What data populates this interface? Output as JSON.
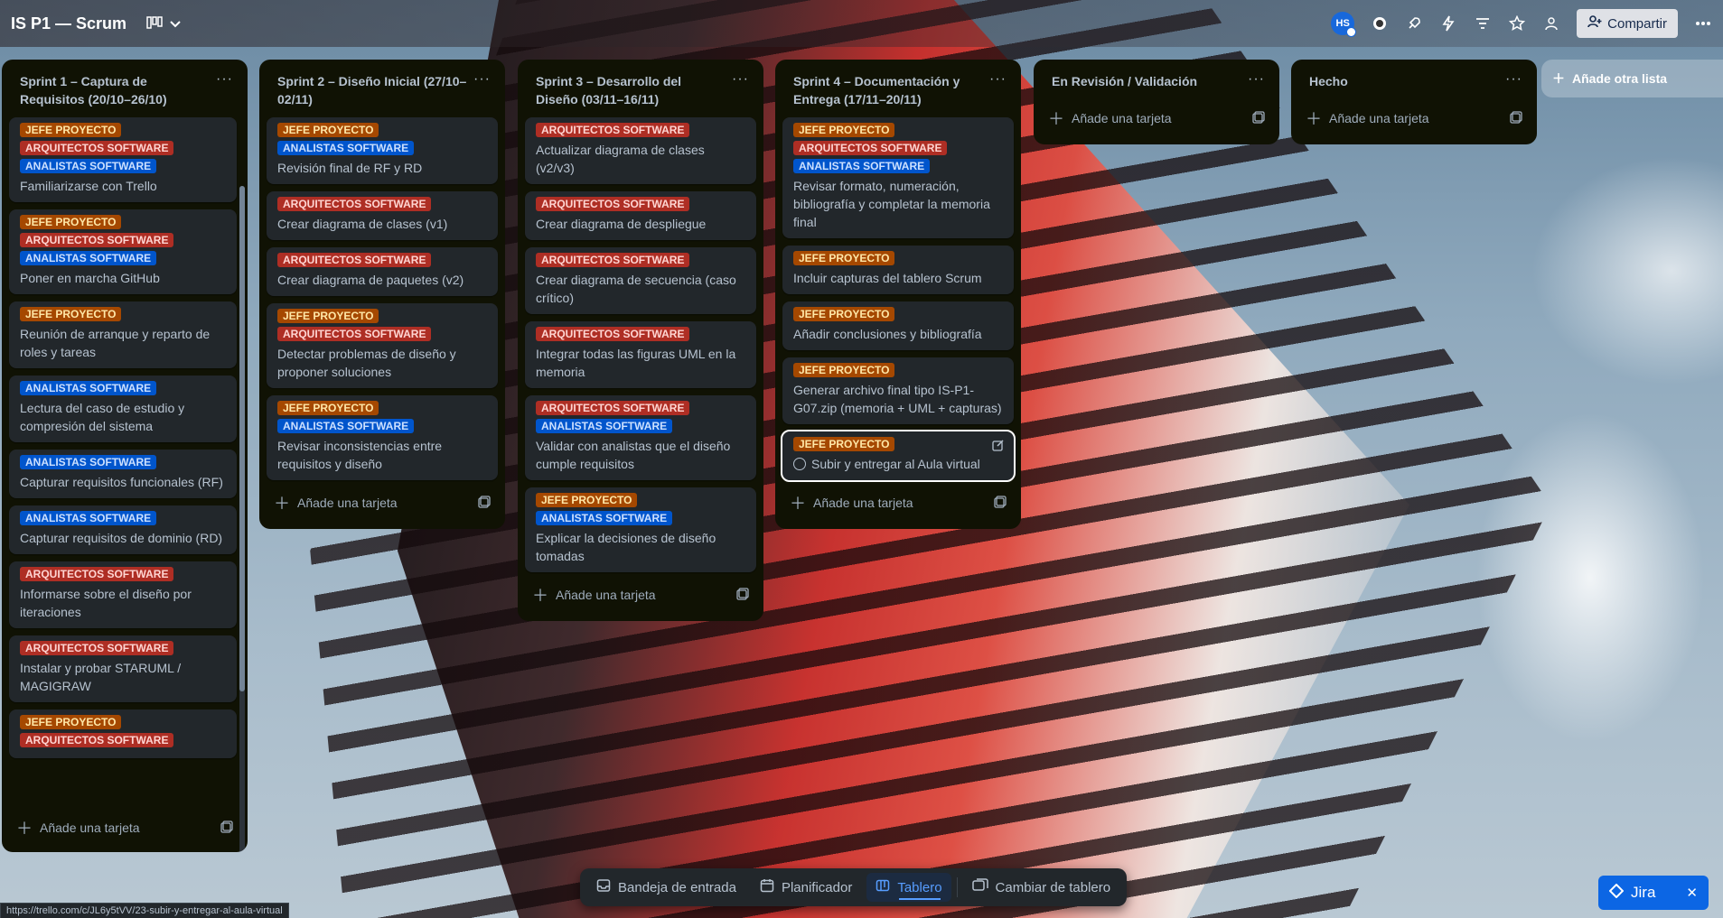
{
  "header": {
    "board_title": "IS P1 — Scrum",
    "avatar_initials": "HS",
    "share_label": "Compartir"
  },
  "label_names": {
    "jefe": "JEFE PROYECTO",
    "arq": "ARQUITECTOS SOFTWARE",
    "ana": "ANALISTAS SOFTWARE"
  },
  "label_colors": {
    "jefe": "#a54800",
    "arq": "#ae2e24",
    "ana": "#0055cc"
  },
  "add_card_label": "Añade una tarjeta",
  "add_list_label": "Añade otra lista",
  "lists": [
    {
      "title": "Sprint 1 – Captura de Requisitos (20/10–26/10)",
      "cards": [
        {
          "labels": [
            "jefe",
            "arq",
            "ana"
          ],
          "title": "Familiarizarse con Trello"
        },
        {
          "labels": [
            "jefe",
            "arq",
            "ana"
          ],
          "title": "Poner en marcha GitHub"
        },
        {
          "labels": [
            "jefe"
          ],
          "title": "Reunión de arranque y reparto de roles y tareas"
        },
        {
          "labels": [
            "ana"
          ],
          "title": "Lectura del caso de estudio y compresión del sistema"
        },
        {
          "labels": [
            "ana"
          ],
          "title": "Capturar requisitos funcionales (RF)"
        },
        {
          "labels": [
            "ana"
          ],
          "title": "Capturar requisitos de dominio (RD)"
        },
        {
          "labels": [
            "arq"
          ],
          "title": "Informarse sobre el diseño por iteraciones"
        },
        {
          "labels": [
            "arq"
          ],
          "title": "Instalar y probar STARUML / MAGIGRAW"
        },
        {
          "labels": [
            "jefe",
            "arq"
          ],
          "title": ""
        }
      ]
    },
    {
      "title": "Sprint 2 – Diseño Inicial (27/10–02/11)",
      "cards": [
        {
          "labels": [
            "jefe",
            "ana"
          ],
          "title": "Revisión final de RF y RD"
        },
        {
          "labels": [
            "arq"
          ],
          "title": "Crear diagrama de clases (v1)"
        },
        {
          "labels": [
            "arq"
          ],
          "title": "Crear diagrama de paquetes (v2)"
        },
        {
          "labels": [
            "jefe",
            "arq"
          ],
          "title": "Detectar problemas de diseño y proponer soluciones"
        },
        {
          "labels": [
            "jefe",
            "ana"
          ],
          "title": "Revisar inconsistencias entre requisitos y diseño"
        }
      ]
    },
    {
      "title": "Sprint 3 – Desarrollo del Diseño (03/11–16/11)",
      "cards": [
        {
          "labels": [
            "arq"
          ],
          "title": "Actualizar diagrama de clases (v2/v3)"
        },
        {
          "labels": [
            "arq"
          ],
          "title": "Crear diagrama de despliegue"
        },
        {
          "labels": [
            "arq"
          ],
          "title": "Crear diagrama de secuencia (caso crítico)"
        },
        {
          "labels": [
            "arq"
          ],
          "title": "Integrar todas las figuras UML en la memoria"
        },
        {
          "labels": [
            "arq",
            "ana"
          ],
          "title": "Validar con analistas que el diseño cumple requisitos"
        },
        {
          "labels": [
            "jefe",
            "ana"
          ],
          "title": "Explicar la decisiones de diseño tomadas"
        }
      ]
    },
    {
      "title": "Sprint 4 – Documentación y Entrega (17/11–20/11)",
      "cards": [
        {
          "labels": [
            "jefe",
            "arq",
            "ana"
          ],
          "title": "Revisar formato, numeración, bibliografía y completar la memoria final"
        },
        {
          "labels": [
            "jefe"
          ],
          "title": "Incluir capturas del tablero Scrum"
        },
        {
          "labels": [
            "jefe"
          ],
          "title": "Añadir conclusiones y bibliografía"
        },
        {
          "labels": [
            "jefe"
          ],
          "title": "Generar archivo final tipo IS-P1-G07.zip (memoria + UML + capturas)"
        },
        {
          "labels": [
            "jefe"
          ],
          "title": "Subir y entregar al Aula virtual",
          "focused": true
        }
      ]
    },
    {
      "title": "En Revisión / Validación",
      "cards": []
    },
    {
      "title": "Hecho",
      "cards": []
    }
  ],
  "bottom_nav": {
    "inbox": "Bandeja de entrada",
    "planner": "Planificador",
    "board": "Tablero",
    "switch": "Cambiar de tablero"
  },
  "jira_label": "Jira",
  "status_url": "https://trello.com/c/JL6y5tVV/23-subir-y-entregar-al-aula-virtual",
  "icons": [
    "view-switcher-icon",
    "chevron-down-icon",
    "copilot-icon",
    "rocket-icon",
    "bolt-icon",
    "filter-icon",
    "star-icon",
    "team-icon",
    "share-icon",
    "more-icon",
    "list-menu-icon",
    "plus-icon",
    "template-icon",
    "edit-icon",
    "inbox-icon",
    "planner-icon",
    "board-icon",
    "switch-board-icon",
    "jira-icon",
    "close-icon"
  ]
}
